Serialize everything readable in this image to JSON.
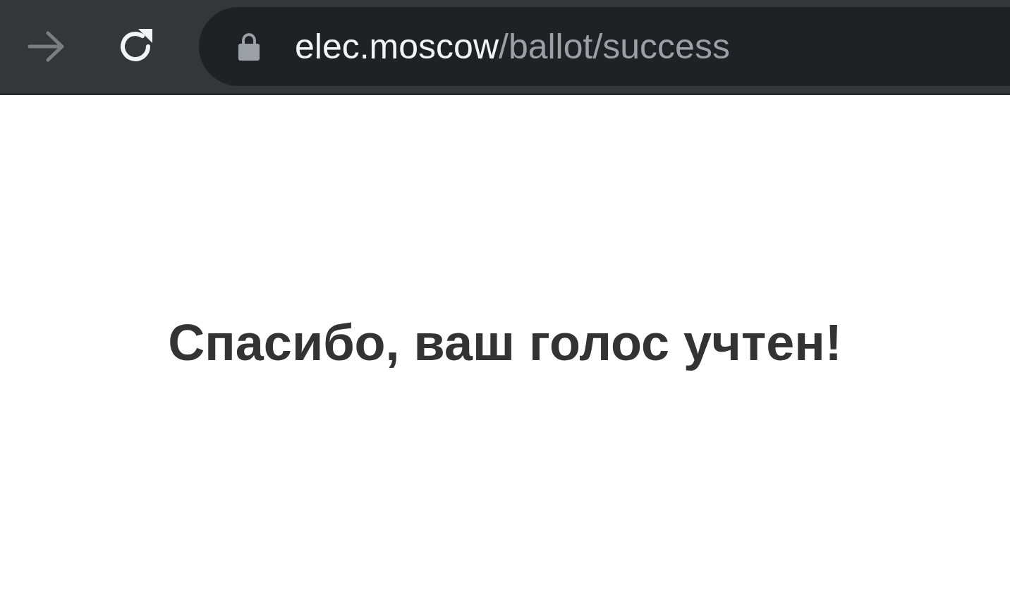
{
  "toolbar": {
    "forward_button": {
      "disabled": true
    },
    "address_bar": {
      "secure": true,
      "host": "elec.moscow",
      "path": "/ballot/success"
    }
  },
  "page": {
    "heading": "Спасибо, ваш голос учтен!"
  }
}
